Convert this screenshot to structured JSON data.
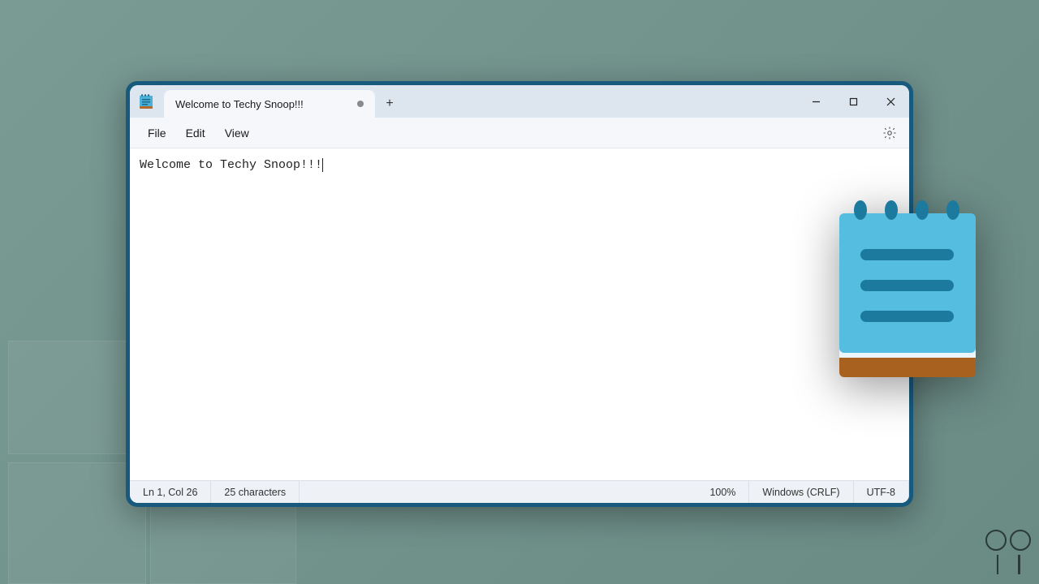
{
  "titlebar": {
    "tab_title": "Welcome to Techy Snoop!!!",
    "new_tab_glyph": "+"
  },
  "menubar": {
    "items": [
      "File",
      "Edit",
      "View"
    ]
  },
  "editor": {
    "content": "Welcome to Techy Snoop!!!"
  },
  "statusbar": {
    "position": "Ln 1, Col 26",
    "char_count": "25 characters",
    "zoom": "100%",
    "line_ending": "Windows (CRLF)",
    "encoding": "UTF-8"
  }
}
